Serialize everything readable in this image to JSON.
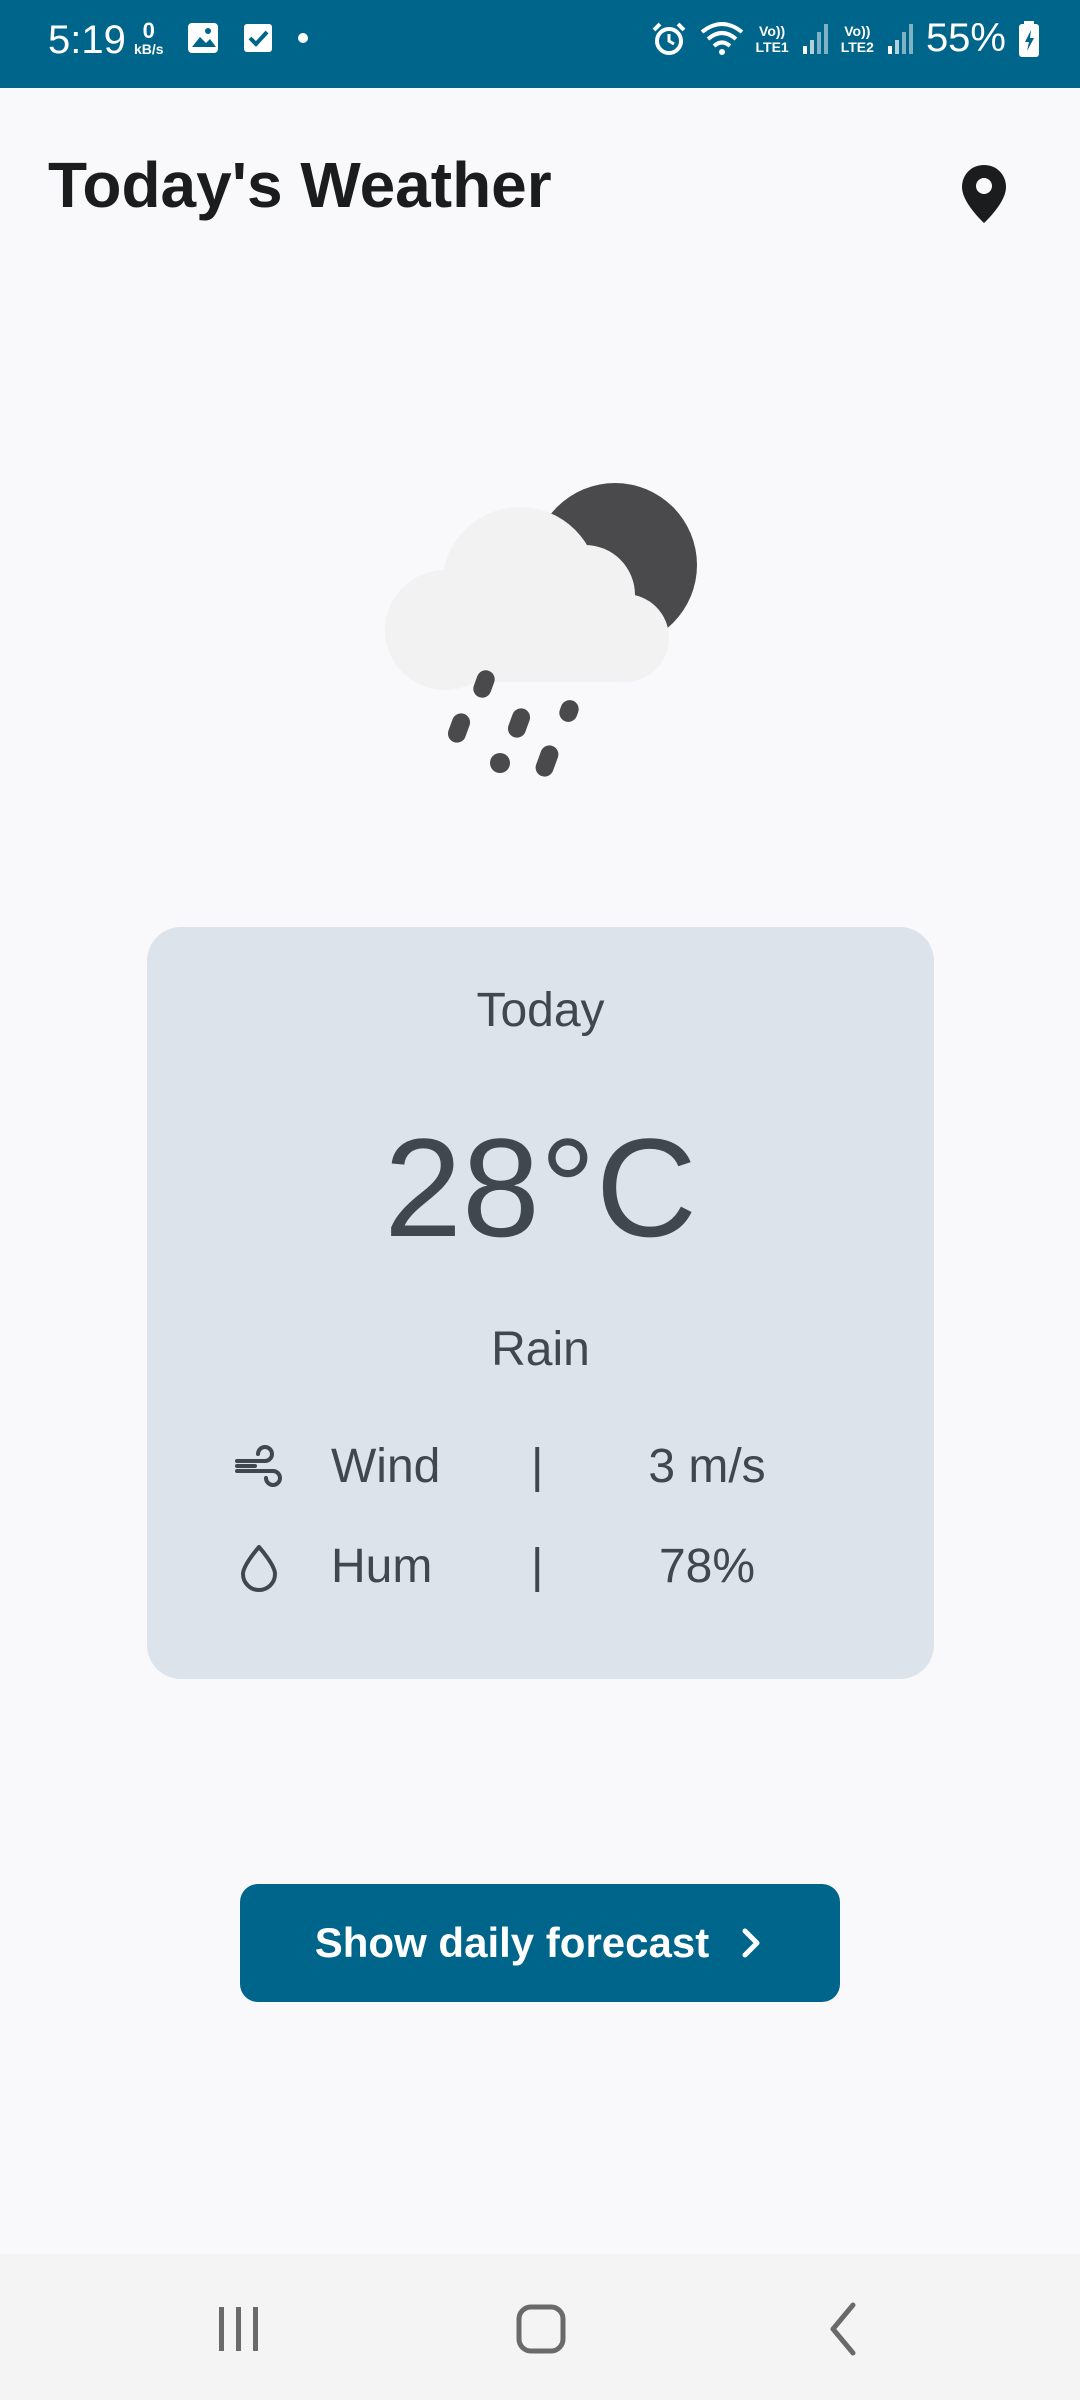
{
  "status_bar": {
    "time": "5:19",
    "net_speed_value": "0",
    "net_speed_unit": "kB/s",
    "sim1": "LTE1",
    "sim2": "LTE2",
    "volte": "Vo))",
    "battery": "55%"
  },
  "app_bar": {
    "title": "Today's Weather",
    "location_icon": "location-pin-icon"
  },
  "weather_icon": "cloud-moon-rain-icon",
  "card": {
    "day": "Today",
    "temperature": "28°C",
    "condition": "Rain",
    "rows": [
      {
        "icon": "wind-icon",
        "label": "Wind",
        "separator": "|",
        "value": "3 m/s"
      },
      {
        "icon": "humidity-drop-icon",
        "label": "Hum",
        "separator": "|",
        "value": "78%"
      }
    ]
  },
  "forecast_button": {
    "label": "Show daily forecast",
    "icon": "chevron-right-icon"
  },
  "colors": {
    "primary": "#00658b",
    "card_background": "#dce3ea",
    "page_background": "#f9f9fc",
    "text": "#40484f"
  }
}
